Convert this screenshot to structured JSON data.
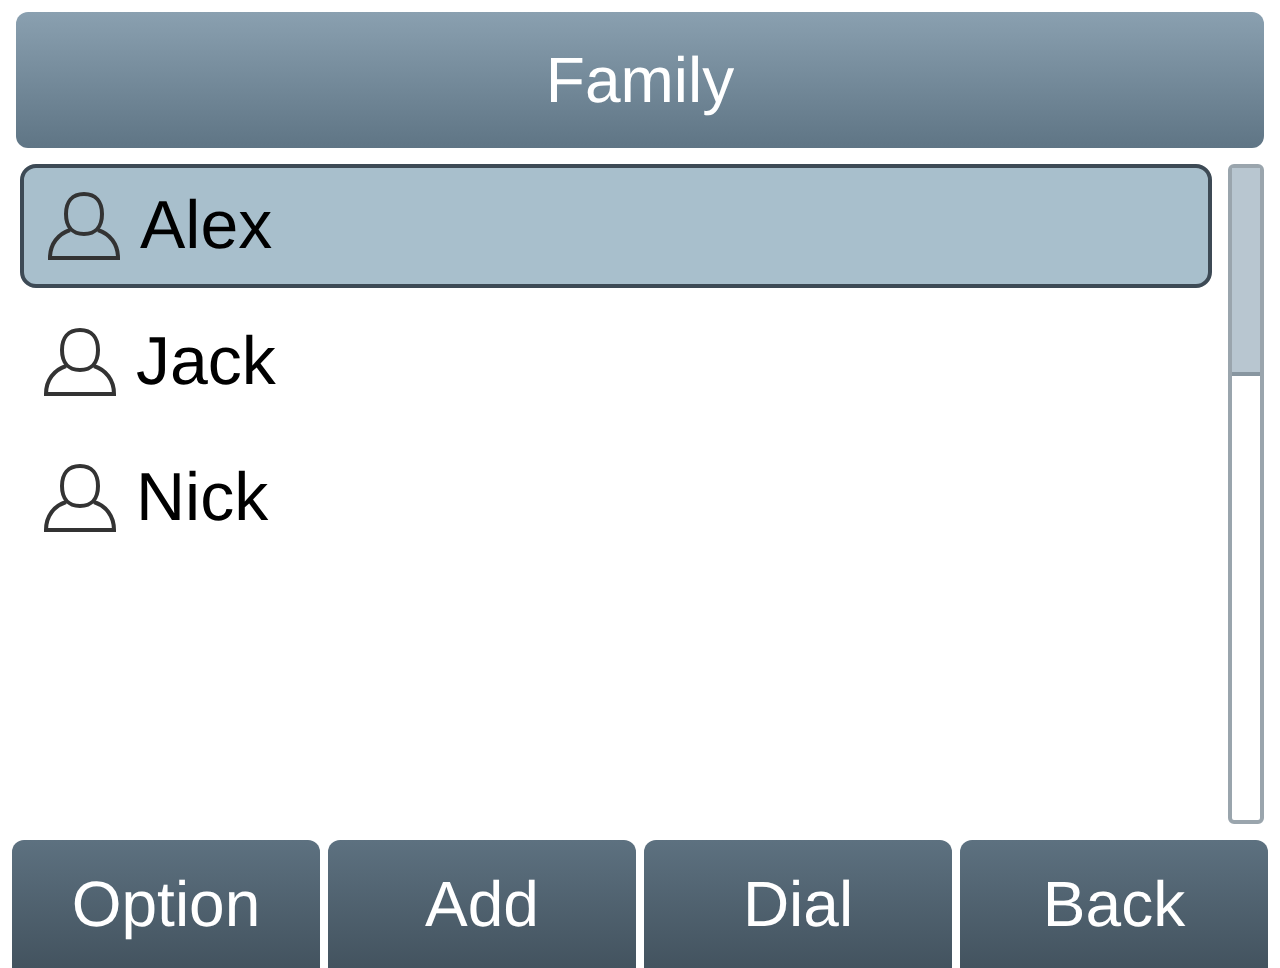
{
  "header": {
    "title": "Family"
  },
  "contacts": [
    {
      "name": "Alex",
      "selected": true
    },
    {
      "name": "Jack",
      "selected": false
    },
    {
      "name": "Nick",
      "selected": false
    }
  ],
  "softkeys": [
    "Option",
    "Add",
    "Dial",
    "Back"
  ]
}
